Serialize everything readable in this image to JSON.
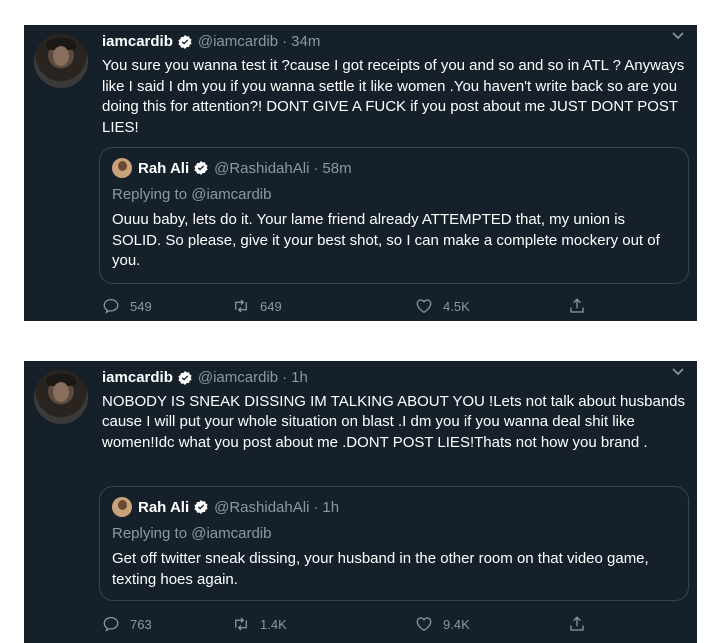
{
  "tweets": [
    {
      "name": "iamcardib",
      "handle": "@iamcardib",
      "time": "34m",
      "text": "You sure you wanna test it ?cause I got receipts of you and so and so in ATL ? Anyways like I said I dm you if you wanna settle it like women .You haven't write back so are you doing this for attention?! DONT GIVE A FUCK if you post about me JUST DONT POST LIES!",
      "quote": {
        "name": "Rah Ali",
        "handle": "@RashidahAli",
        "time": "58m",
        "replying": "Replying to @iamcardib",
        "text": "Ouuu baby, lets do it. Your lame friend already ATTEMPTED that, my union is SOLID. So please, give it your best shot, so I can make a complete mockery out of you."
      },
      "replies": "549",
      "retweets": "649",
      "likes": "4.5K"
    },
    {
      "name": "iamcardib",
      "handle": "@iamcardib",
      "time": "1h",
      "text": "NOBODY IS SNEAK DISSING IM TALKING ABOUT YOU !Lets not talk about husbands cause I will put your whole situation on blast .I dm you if you wanna deal shit like women!Idc what you post about me .DONT POST LIES!Thats not how you brand .",
      "quote": {
        "name": "Rah Ali",
        "handle": "@RashidahAli",
        "time": "1h",
        "replying": "Replying to @iamcardib",
        "text": "Get off twitter sneak dissing, your husband in the other room on that video game, texting hoes again."
      },
      "replies": "763",
      "retweets": "1.4K",
      "likes": "9.4K"
    }
  ],
  "icons": {
    "verified": "verified-badge-icon",
    "reply": "reply-icon",
    "retweet": "retweet-icon",
    "like": "heart-icon",
    "share": "share-icon",
    "more": "chevron-down-icon"
  },
  "colors": {
    "background": "#15202b",
    "text": "#ffffff",
    "muted": "#8899a6",
    "border": "#38444d",
    "verified": "#1da1f2"
  }
}
